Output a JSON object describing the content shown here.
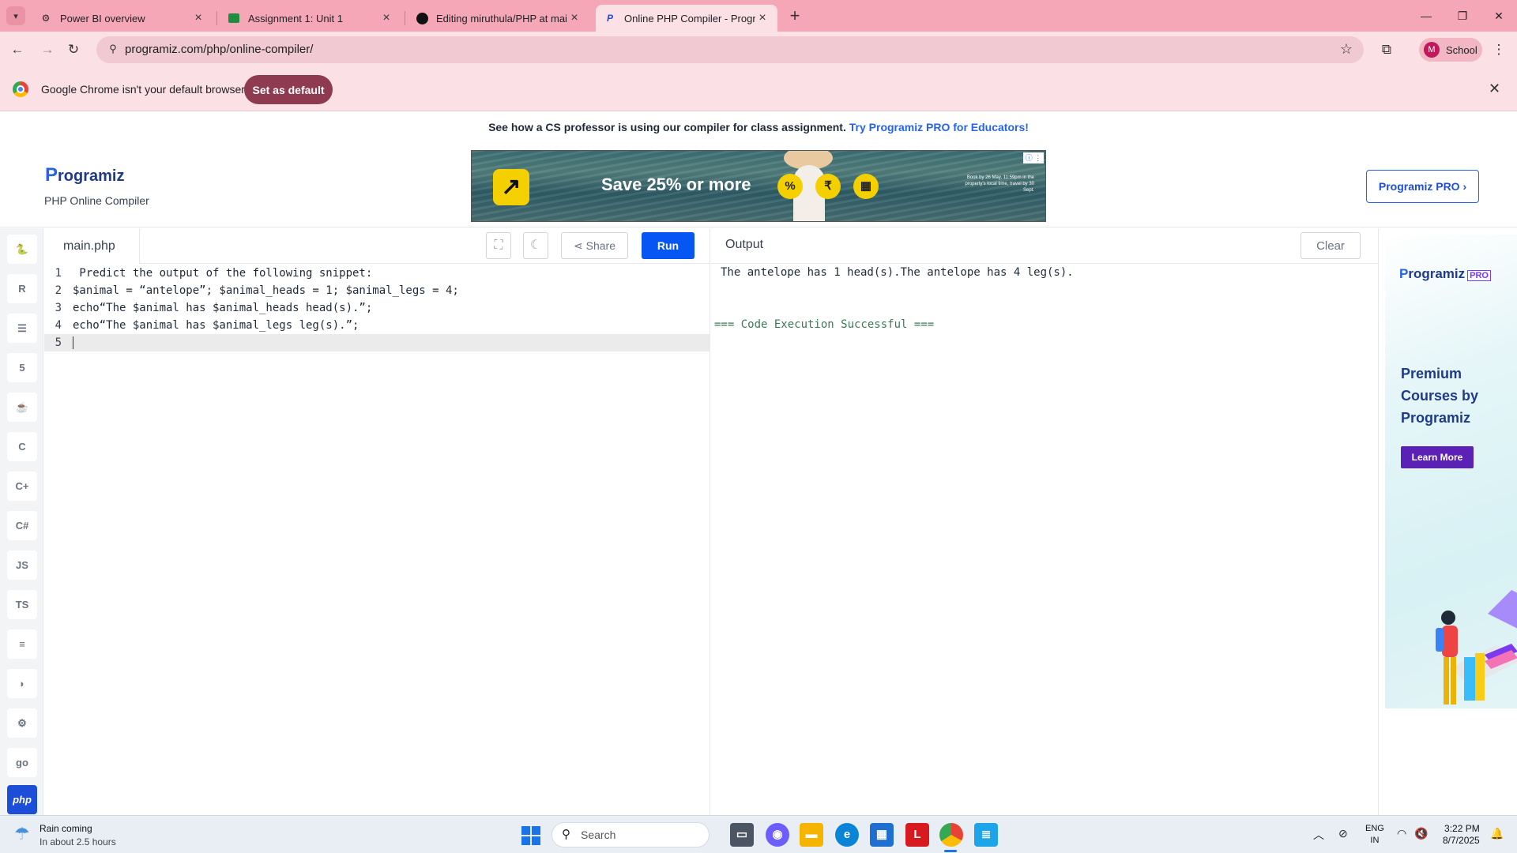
{
  "browser": {
    "tabs": [
      {
        "title": "Power BI overview",
        "icon": "gear-icon"
      },
      {
        "title": "Assignment 1: Unit 1",
        "icon": "classroom-icon"
      },
      {
        "title": "Editing miruthula/PHP at main",
        "icon": "github-icon"
      },
      {
        "title": "Online PHP Compiler - Program",
        "icon": "programiz-icon"
      }
    ],
    "url": "programiz.com/php/online-compiler/",
    "profile_initial": "M",
    "profile_label": "School"
  },
  "infobar": {
    "message": "Google Chrome isn't your default browser",
    "button": "Set as default"
  },
  "promo": {
    "text": "See how a CS professor is using our compiler for class assignment.",
    "link": "Try Programiz PRO for Educators!"
  },
  "header": {
    "logo": "rogramiz",
    "logo_initial": "P",
    "subtitle": "PHP Online Compiler",
    "pro_button": "Programiz PRO ›"
  },
  "ad": {
    "headline": "Save 25% or more",
    "fine_print": "Book by 26 May, 11:59pm in the property's local time, travel by 30 Sept.",
    "icons": [
      "%",
      "₹",
      "▦"
    ]
  },
  "languages": [
    "python",
    "R",
    "sql",
    "html",
    "java",
    "c",
    "c++",
    "c#",
    "JS",
    "TS",
    "go",
    "php"
  ],
  "editor": {
    "filename": "main.php",
    "share": "Share",
    "run": "Run",
    "lines": [
      {
        "n": "1",
        "code": " Predict the output of the following snippet:"
      },
      {
        "n": "2",
        "code": "$animal = “antelope”; $animal_heads = 1; $animal_legs = 4;"
      },
      {
        "n": "3",
        "code": "echo“The $animal has $animal_heads head(s).”;"
      },
      {
        "n": "4",
        "code": "echo“The $animal has $animal_legs leg(s).”;"
      },
      {
        "n": "5",
        "code": ""
      }
    ]
  },
  "output": {
    "title": "Output",
    "clear": "Clear",
    "result": "The antelope has 1 head(s).The antelope has 4 leg(s).",
    "status": "=== Code Execution Successful ==="
  },
  "side_ad": {
    "logo": "rogramiz",
    "logo_initial": "P",
    "badge": "PRO",
    "headline": "Premium Courses by Programiz",
    "button": "Learn More"
  },
  "taskbar": {
    "weather_title": "Rain coming",
    "weather_sub": "In about 2.5 hours",
    "search": "Search",
    "lang_1": "ENG",
    "lang_2": "IN",
    "time": "3:22 PM",
    "date": "8/7/2025"
  },
  "colors": {
    "tab_strip": "#f6a7b7",
    "run_button": "#0556f3",
    "status_text": "#3b7a57"
  }
}
